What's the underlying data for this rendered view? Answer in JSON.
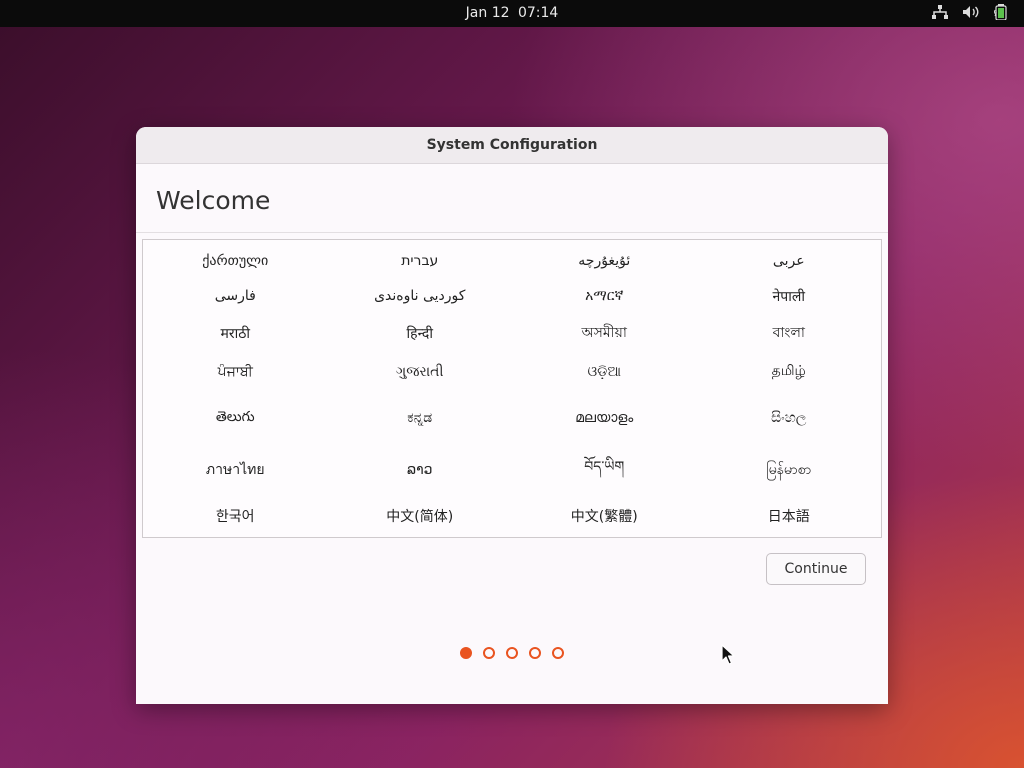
{
  "topbar": {
    "date": "Jan 12",
    "time": "07:14",
    "icons": [
      "network-icon",
      "volume-icon",
      "battery-icon"
    ]
  },
  "dialog": {
    "title": "System Configuration",
    "heading": "Welcome",
    "continue_label": "Continue",
    "languages": [
      "ქართული",
      "עברית",
      "ئۇيغۇرچە",
      "عربى",
      "فارسی",
      "کوردیی ناوەندی",
      "አማርኛ",
      "नेपाली",
      "मराठी",
      "हिन्दी",
      "অসমীয়া",
      "বাংলা",
      "ਪੰਜਾਬੀ",
      "ગુજરાતી",
      "ଓଡ଼ିଆ",
      "தமிழ்",
      "తెలుగు",
      "ಕನ್ನಡ",
      "മലയാളം",
      "සිංහල",
      "ภาษาไทย",
      "ລາວ",
      "བོད་ཡིག",
      "မြန်မာစာ",
      "한국어",
      "中文(简体)",
      "中文(繁體)",
      "日本語"
    ],
    "pagination": {
      "current": 1,
      "total": 5
    }
  },
  "colors": {
    "accent": "#e95420",
    "topbar": "#0b0b0b"
  }
}
